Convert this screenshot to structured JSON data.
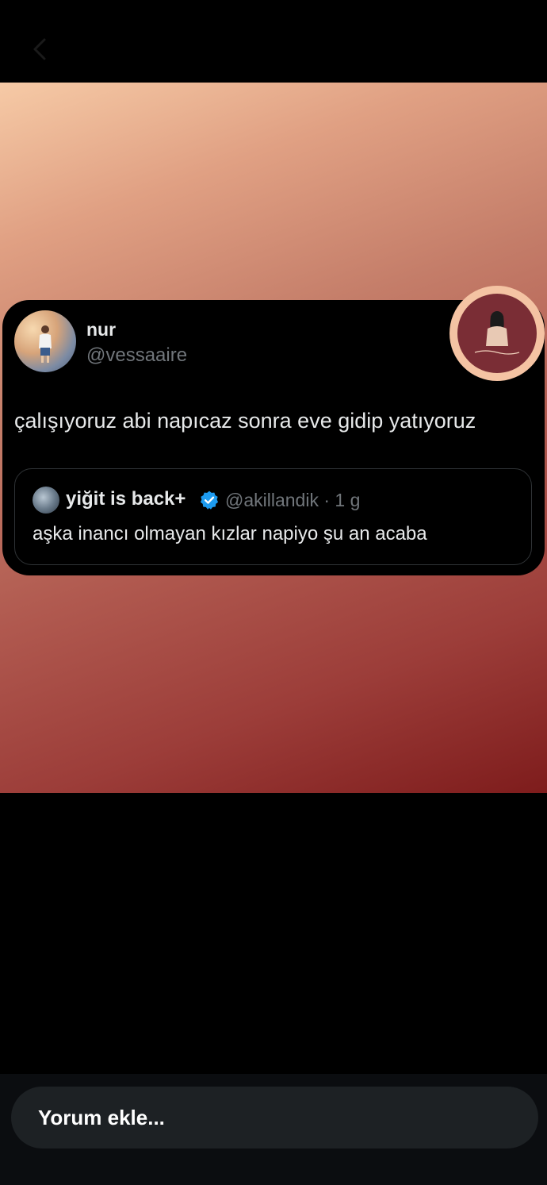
{
  "tweet": {
    "display_name": "nur",
    "handle": "@vessaaire",
    "text": "çalışıyoruz abi napıcaz sonra eve gidip yatıyoruz",
    "quote": {
      "name": "yiğit is back+",
      "handle_time": "@akillandik · 1 g",
      "text": "aşka inancı olmayan kızlar napiyo şu an acaba",
      "verified_color": "#1d9bf0"
    }
  },
  "comment": {
    "placeholder": "Yorum ekle..."
  },
  "icons": {
    "back": "chevron-left-icon",
    "verified": "verified-badge-icon"
  },
  "colors": {
    "gradient_top": "#f6caa6",
    "gradient_bottom": "#7e1c1c",
    "logo_bg": "#7a2d35"
  }
}
